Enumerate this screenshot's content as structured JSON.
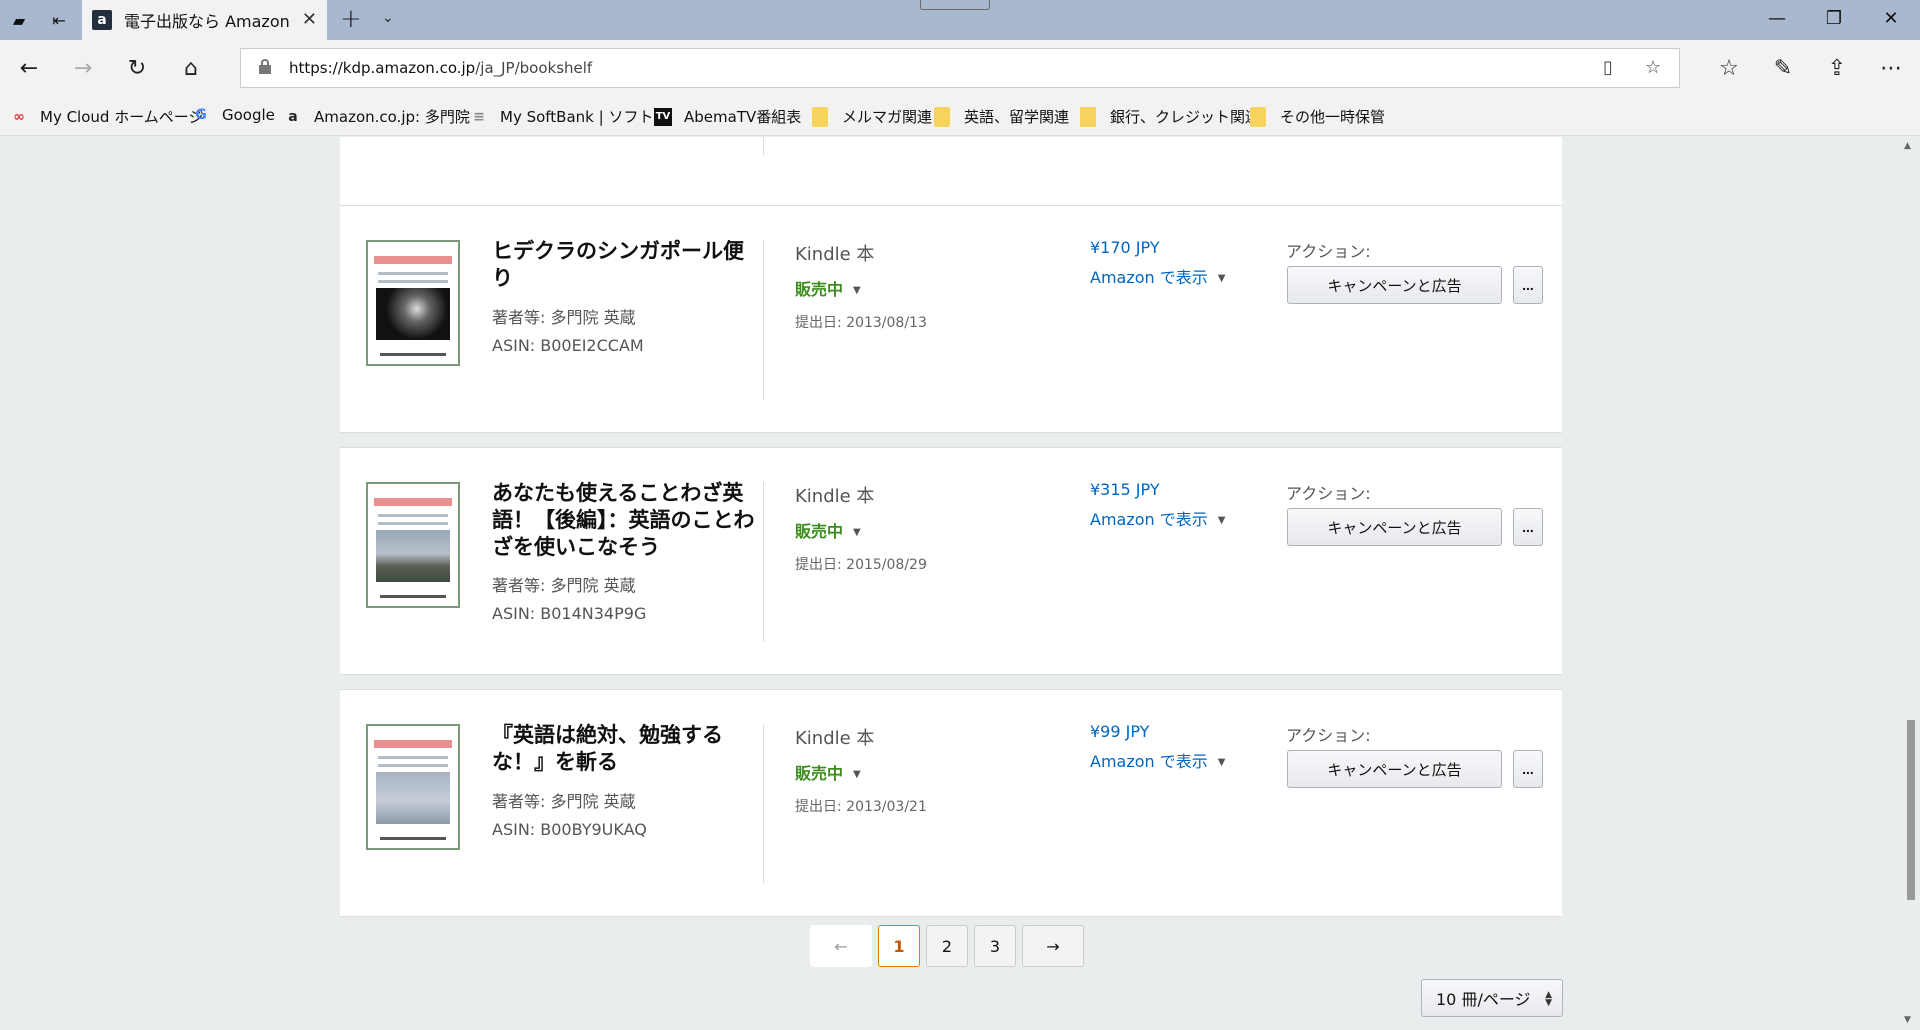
{
  "browser": {
    "tab_title": "電子出版なら Amazon K",
    "url_host": "https://kdp.amazon.co.jp",
    "url_path": "/ja_JP/bookshelf"
  },
  "bookmarks": [
    {
      "label": "My Cloud ホームページ",
      "icon": "cloud-icon"
    },
    {
      "label": "Google",
      "icon": "google-icon"
    },
    {
      "label": "Amazon.co.jp: 多門院",
      "icon": "amazon-icon"
    },
    {
      "label": "My SoftBank | ソフトバ",
      "icon": "softbank-icon"
    },
    {
      "label": "AbemaTV番組表",
      "icon": "abematv-icon"
    },
    {
      "label": "メルマガ関連",
      "icon": "folder-icon"
    },
    {
      "label": "英語、留学関連",
      "icon": "folder-icon"
    },
    {
      "label": "銀行、クレジット関連",
      "icon": "folder-icon"
    },
    {
      "label": "その他一時保管",
      "icon": "folder-icon"
    }
  ],
  "books": [
    {
      "title": "ヒデクラのシンガポール便り",
      "author": "著者等: 多門院 英蔵",
      "asin": "ASIN: B00EI2CCAM",
      "format": "Kindle 本",
      "status": "販売中",
      "submitted": "提出日: 2013/08/13",
      "price": "¥170 JPY",
      "view_link": "Amazon で表示",
      "actions_label": "アクション:",
      "campaign_button": "キャンペーンと広告",
      "more_button": "..."
    },
    {
      "title": "あなたも使えることわざ英語！【後編】：英語のことわざを使いこなそう",
      "author": "著者等: 多門院 英蔵",
      "asin": "ASIN: B014N34P9G",
      "format": "Kindle 本",
      "status": "販売中",
      "submitted": "提出日: 2015/08/29",
      "price": "¥315 JPY",
      "view_link": "Amazon で表示",
      "actions_label": "アクション:",
      "campaign_button": "キャンペーンと広告",
      "more_button": "..."
    },
    {
      "title": "『英語は絶対、勉強するな！』を斬る",
      "author": "著者等: 多門院 英蔵",
      "asin": "ASIN: B00BY9UKAQ",
      "format": "Kindle 本",
      "status": "販売中",
      "submitted": "提出日: 2013/03/21",
      "price": "¥99 JPY",
      "view_link": "Amazon で表示",
      "actions_label": "アクション:",
      "campaign_button": "キャンペーンと広告",
      "more_button": "..."
    }
  ],
  "pagination": {
    "prev": "←",
    "pages": [
      "1",
      "2",
      "3"
    ],
    "current": "1",
    "next": "→",
    "per_page": "10 冊/ページ"
  },
  "colors": {
    "status_green": "#3c8c1f",
    "link_blue": "#0066c0",
    "current_page_orange": "#e47911"
  }
}
